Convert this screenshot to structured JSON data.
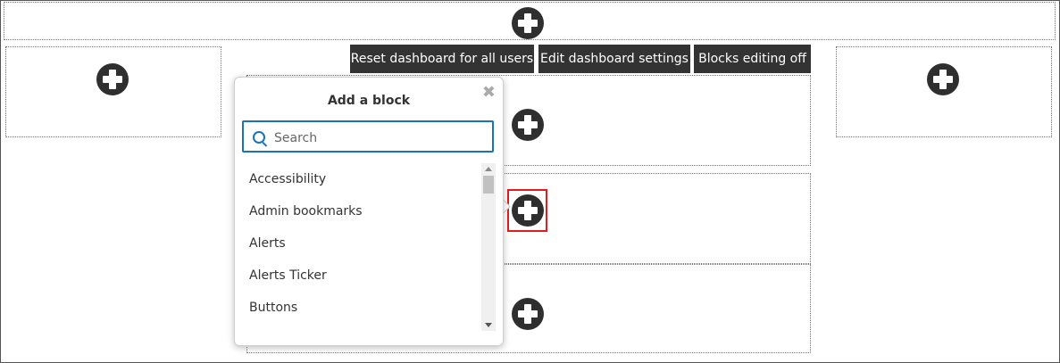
{
  "toolbar": {
    "reset_label": "Reset dashboard for all users",
    "edit_label": "Edit dashboard settings",
    "editing_label": "Blocks editing off"
  },
  "popover": {
    "title": "Add a block",
    "close_glyph": "✖",
    "search_placeholder": "Search",
    "search_value": "",
    "items": [
      {
        "label": "Accessibility"
      },
      {
        "label": "Admin bookmarks"
      },
      {
        "label": "Alerts"
      },
      {
        "label": "Alerts Ticker"
      },
      {
        "label": "Buttons"
      }
    ]
  },
  "icons": {
    "add": "plus-circle-icon",
    "search": "search-icon",
    "close": "close-icon"
  },
  "colors": {
    "toolbar_bg": "#333333",
    "accent": "#1a73b8",
    "highlight": "#e21c1c"
  }
}
